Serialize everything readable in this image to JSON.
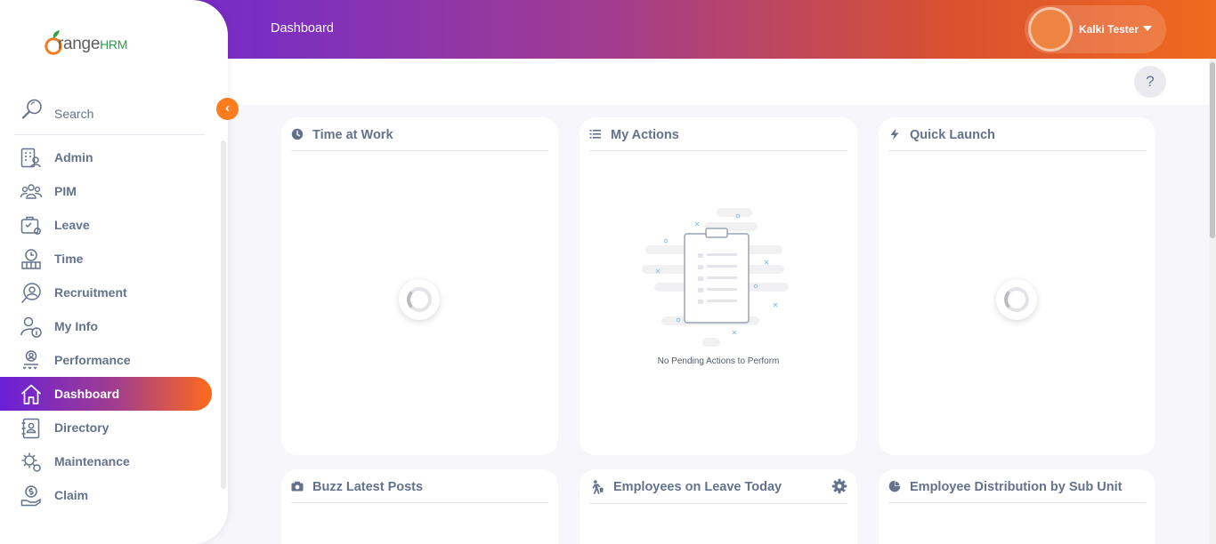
{
  "app": {
    "logo_text": "OrangeHRM",
    "logo_main": "range",
    "logo_suffix": "HRM"
  },
  "topbar": {
    "title": "Dashboard",
    "user_name": "Kalki Tester"
  },
  "help": {
    "label": "?"
  },
  "sidebar": {
    "search_label": "Search",
    "collapse_icon": "chevron-left-icon",
    "items": [
      {
        "label": "Admin",
        "icon": "admin-icon"
      },
      {
        "label": "PIM",
        "icon": "pim-icon"
      },
      {
        "label": "Leave",
        "icon": "leave-icon"
      },
      {
        "label": "Time",
        "icon": "time-icon"
      },
      {
        "label": "Recruitment",
        "icon": "recruitment-icon"
      },
      {
        "label": "My Info",
        "icon": "my-info-icon"
      },
      {
        "label": "Performance",
        "icon": "performance-icon"
      },
      {
        "label": "Dashboard",
        "icon": "home-icon",
        "active": true
      },
      {
        "label": "Directory",
        "icon": "directory-icon"
      },
      {
        "label": "Maintenance",
        "icon": "maintenance-icon"
      },
      {
        "label": "Claim",
        "icon": "claim-icon"
      }
    ]
  },
  "widgets": {
    "time_at_work": {
      "title": "Time at Work",
      "icon": "clock-icon"
    },
    "my_actions": {
      "title": "My Actions",
      "icon": "list-icon",
      "empty_text": "No Pending Actions to Perform"
    },
    "quick_launch": {
      "title": "Quick Launch",
      "icon": "lightning-icon"
    },
    "buzz": {
      "title": "Buzz Latest Posts",
      "icon": "camera-icon"
    },
    "leave_today": {
      "title": "Employees on Leave Today",
      "icon": "walking-person-icon",
      "settings_icon": "gear-icon"
    },
    "distribution": {
      "title": "Employee Distribution by Sub Unit",
      "icon": "pie-chart-icon"
    }
  },
  "colors": {
    "brand_orange": "#ff7b1d",
    "brand_purple": "#6a1fd8",
    "text_muted": "#64728c"
  }
}
